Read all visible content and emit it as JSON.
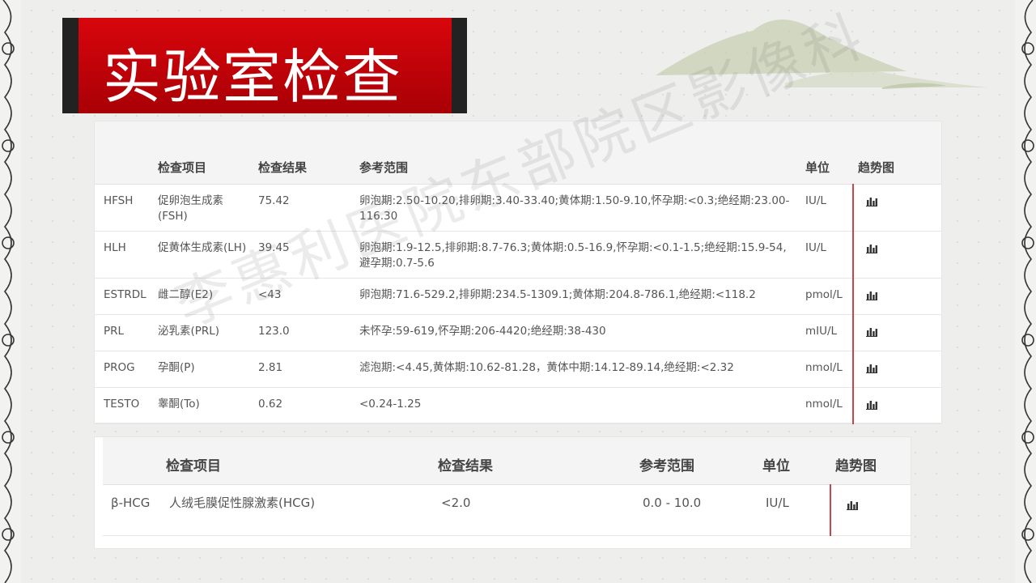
{
  "slide_title": "实验室检查",
  "watermark": "李惠利医院东部院区影像科",
  "table1": {
    "headers": [
      "",
      "检查项目",
      "检查结果",
      "参考范围",
      "单位",
      "趋势图"
    ],
    "rows": [
      {
        "code": "HFSH",
        "name": "促卵泡生成素(FSH)",
        "result": "75.42",
        "range": "卵泡期:2.50-10.20,排卵期:3.40-33.40;黄体期:1.50-9.10,怀孕期:<0.3;绝经期:23.00-116.30",
        "unit": "IU/L"
      },
      {
        "code": "HLH",
        "name": "促黄体生成素(LH)",
        "result": "39.45",
        "range": "卵泡期:1.9-12.5,排卵期:8.7-76.3;黄体期:0.5-16.9,怀孕期:<0.1-1.5;绝经期:15.9-54,避孕期:0.7-5.6",
        "unit": "IU/L"
      },
      {
        "code": "ESTRDL",
        "name": "雌二醇(E2)",
        "result": "<43",
        "range": "卵泡期:71.6-529.2,排卵期:234.5-1309.1;黄体期:204.8-786.1,绝经期:<118.2",
        "unit": "pmol/L"
      },
      {
        "code": "PRL",
        "name": "泌乳素(PRL)",
        "result": "123.0",
        "range": "未怀孕:59-619,怀孕期:206-4420;绝经期:38-430",
        "unit": "mIU/L"
      },
      {
        "code": "PROG",
        "name": "孕酮(P)",
        "result": "2.81",
        "range": "滤泡期:<4.45,黄体期:10.62-81.28，黄体中期:14.12-89.14,绝经期:<2.32",
        "unit": "nmol/L"
      },
      {
        "code": "TESTO",
        "name": "睾酮(To)",
        "result": "0.62",
        "range": "<0.24-1.25",
        "unit": "nmol/L"
      }
    ]
  },
  "table2": {
    "headers": [
      "",
      "检查项目",
      "检查结果",
      "参考范围",
      "单位",
      "趋势图"
    ],
    "rows": [
      {
        "code": "β-HCG",
        "name": "人绒毛膜促性腺激素(HCG)",
        "result": "<2.0",
        "range": "0.0 - 10.0",
        "unit": "IU/L"
      }
    ]
  },
  "icons": {
    "trend": "bar-chart-icon"
  },
  "colors": {
    "title_bg": "#c4030a",
    "title_frame": "#222222",
    "trend_divider": "#c8454a"
  }
}
